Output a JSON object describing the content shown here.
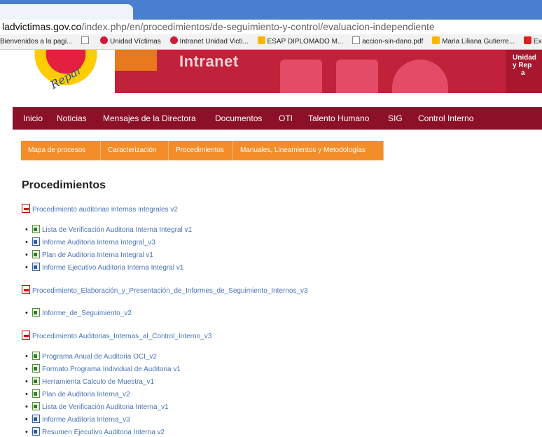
{
  "browser": {
    "url_host": "ladvictimas.gov.co",
    "url_path": "/index.php/en/procedimientos/de-seguimiento-y-control/evaluacion-independiente",
    "bookmarks": [
      {
        "label": "Bienvenidos a la pagi...",
        "icon": "none"
      },
      {
        "label": "",
        "icon": "page-icon"
      },
      {
        "label": "Unidad Víctimas",
        "icon": "victimas-icon"
      },
      {
        "label": "Intranet Unidad Victi...",
        "icon": "victimas-icon"
      },
      {
        "label": "ESAP DIPLOMADO M...",
        "icon": "esap-icon"
      },
      {
        "label": "accion-sin-dano.pdf",
        "icon": "page-icon"
      },
      {
        "label": "Maria Liliana Gutierre...",
        "icon": "outlook-icon"
      },
      {
        "label": "Exclusiva: Entrevis",
        "icon": "youtube-icon"
      }
    ]
  },
  "banner": {
    "logo_script": "Repar",
    "intranet_label": "Intranet",
    "right_lines": [
      "Unidad",
      "y Rep",
      "a"
    ]
  },
  "main_nav": [
    "Inicio",
    "Noticias",
    "Mensajes de la Directora",
    "Documentos",
    "OTI",
    "Talento Humano",
    "SIG",
    "Control Interno"
  ],
  "sub_nav": [
    "Mapa de procesos",
    "Caracterización",
    "Procedimientos",
    "Manuales, Lineamientos y Metodologías"
  ],
  "page_title": "Procedimientos",
  "procedures": [
    {
      "title": "Procedimiento auditorias internas integrales v2",
      "items": [
        {
          "label": "Lista de Verificación Auditoria Interna Integral v1",
          "icon": "excel"
        },
        {
          "label": "Informe Auditoria Interna Integral_v3",
          "icon": "word"
        },
        {
          "label": "Plan de Auditoria Interna Integral v1",
          "icon": "excel"
        },
        {
          "label": "Informe Ejecutivo  Auditoria Interna Integral v1",
          "icon": "word"
        }
      ]
    },
    {
      "title": "Procedimiento_Elaboración_y_Presentación_de_Informes_de_Seguimiento_Internos_v3",
      "items": [
        {
          "label": "Informe_de_Seguimiento_v2",
          "icon": "excel"
        }
      ]
    },
    {
      "title": "Procedimiento Auditorias_Internas_al_Control_Interno_v3",
      "items": [
        {
          "label": "Programa Anual de Auditoria OCI_v2",
          "icon": "excel"
        },
        {
          "label": "Formato Programa Individual de Auditoria v1",
          "icon": "excel"
        },
        {
          "label": "Herramienta Calculo de Muestra_v1",
          "icon": "excel"
        },
        {
          "label": "Plan de Auditoria Interna_v2",
          "icon": "excel"
        },
        {
          "label": "Lista de Verificación Auditoria Interna_v1",
          "icon": "excel"
        },
        {
          "label": "Informe Auditoria Interna_v3",
          "icon": "word"
        },
        {
          "label": "Resumen Ejecutivo Auditoria Interna  v2",
          "icon": "word"
        }
      ]
    }
  ]
}
